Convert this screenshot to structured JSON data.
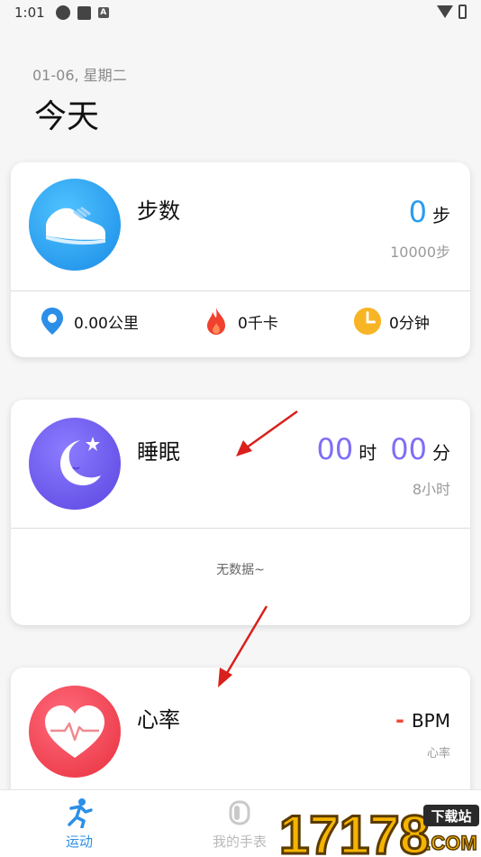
{
  "status_bar": {
    "time": "1:01",
    "a_icon_text": "A"
  },
  "header": {
    "date": "01-06, 星期二",
    "title": "今天"
  },
  "steps_card": {
    "label": "步数",
    "value": "0",
    "unit": "步",
    "goal": "10000步",
    "distance": "0.00公里",
    "calories": "0千卡",
    "duration": "0分钟",
    "icon": "shoe-icon"
  },
  "sleep_card": {
    "label": "睡眠",
    "hours": "00",
    "hours_unit": "时",
    "minutes": "00",
    "minutes_unit": "分",
    "goal": "8小时",
    "empty_text": "无数据~",
    "icon": "moon-icon"
  },
  "heart_card": {
    "label": "心率",
    "value": "-",
    "unit": "BPM",
    "sub": "心率",
    "icon": "heart-icon"
  },
  "tabbar": {
    "tabs": [
      {
        "label": "运动",
        "icon": "running-icon",
        "active": true
      },
      {
        "label": "我的手表",
        "icon": "watch-icon",
        "active": false
      }
    ]
  },
  "watermark": {
    "text": "17178",
    "badge": "下载站",
    "suffix": ".COM"
  },
  "colors": {
    "accent": "#2b9cf0",
    "sleep": "#7f6ff5",
    "heart": "#f04b3a",
    "arrow": "#d9201c"
  }
}
